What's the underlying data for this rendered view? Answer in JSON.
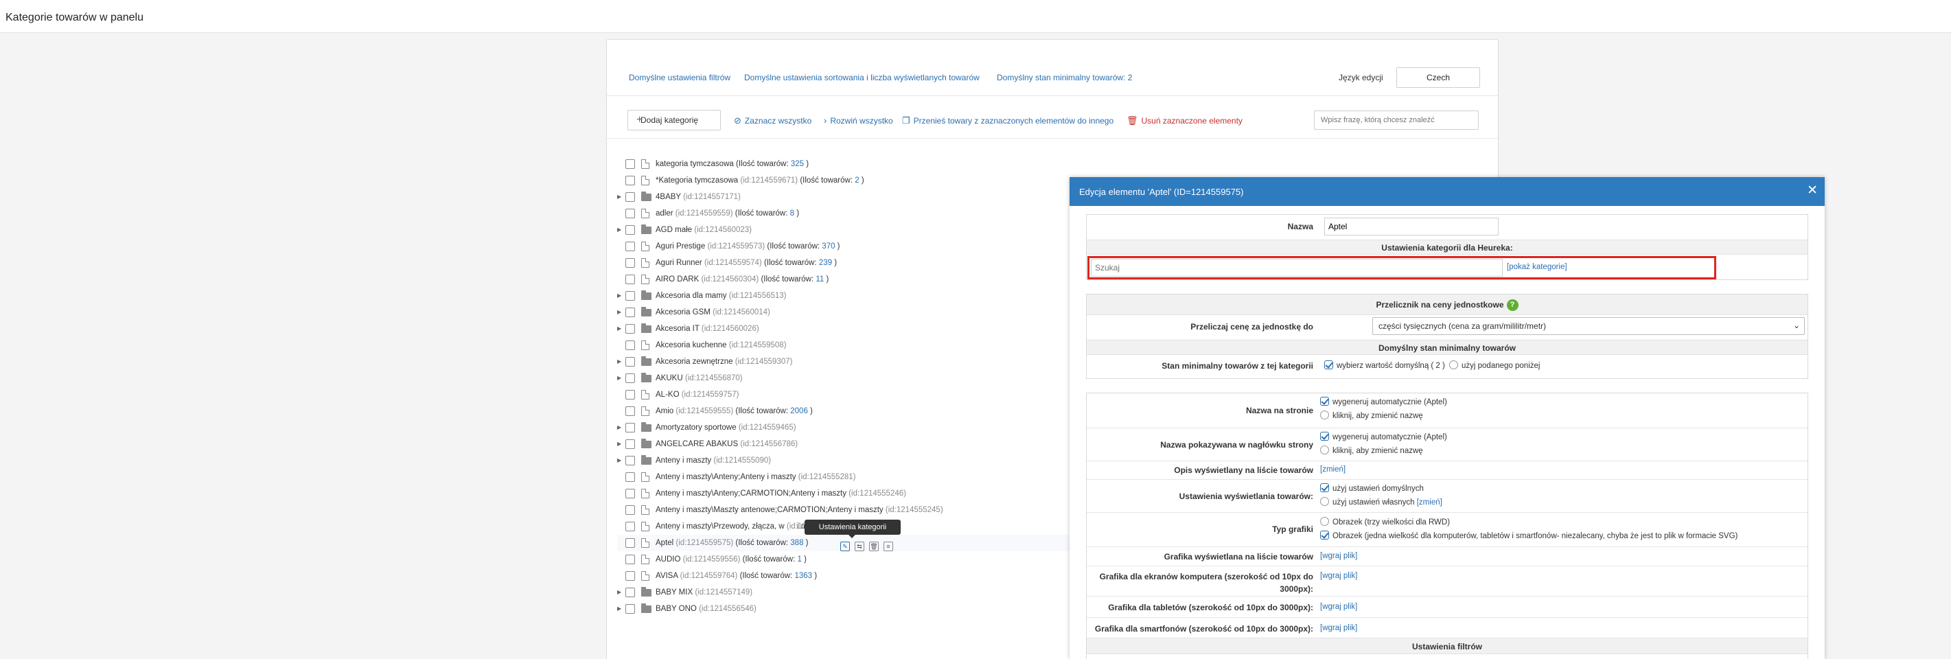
{
  "page": {
    "title": "Kategorie towarów w panelu"
  },
  "tabs": [
    "Domyślne ustawienia filtrów",
    "Domyślne ustawienia sortowania i liczba wyświetlanych towarów",
    "Domyślny stan minimalny towarów: 2"
  ],
  "language": {
    "label": "Język edycji",
    "value": "Czech"
  },
  "toolbar": {
    "add_label": "Dodaj kategorię",
    "select_all": "Zaznacz wszystko",
    "expand_all": "Rozwiń wszystko",
    "move_products": "Przenieś towary z zaznaczonych elementów do innego",
    "delete_selected": "Usuń zaznaczone elementy",
    "search_placeholder": "Wpisz frazę, którą chcesz znaleźć"
  },
  "tree": [
    {
      "name": "kategoria tymczasowa",
      "id": "",
      "count_label": "(Ilość towarów: ",
      "count": "325",
      "count_end": " )",
      "folder": false,
      "expandable": false
    },
    {
      "name": "*Kategoria tymczasowa",
      "id": "(id:1214559671)",
      "count_label": "(Ilość towarów: ",
      "count": "2",
      "count_end": " )",
      "folder": false,
      "expandable": false
    },
    {
      "name": "4BABY",
      "id": "(id:1214557171)",
      "count_label": "",
      "count": "",
      "count_end": "",
      "folder": true,
      "expandable": true
    },
    {
      "name": "adler",
      "id": "(id:1214559559)",
      "count_label": "(Ilość towarów: ",
      "count": "8",
      "count_end": " )",
      "folder": false,
      "expandable": false
    },
    {
      "name": "AGD małe",
      "id": "(id:1214560023)",
      "count_label": "",
      "count": "",
      "count_end": "",
      "folder": true,
      "expandable": true
    },
    {
      "name": "Aguri Prestige",
      "id": "(id:1214559573)",
      "count_label": "(Ilość towarów: ",
      "count": "370",
      "count_end": " )",
      "folder": false,
      "expandable": false
    },
    {
      "name": "Aguri Runner",
      "id": "(id:1214559574)",
      "count_label": "(Ilość towarów: ",
      "count": "239",
      "count_end": " )",
      "folder": false,
      "expandable": false
    },
    {
      "name": "AIRO DARK",
      "id": "(id:1214560304)",
      "count_label": "(Ilość towarów: ",
      "count": "11",
      "count_end": " )",
      "folder": false,
      "expandable": false
    },
    {
      "name": "Akcesoria dla mamy",
      "id": "(id:1214556513)",
      "count_label": "",
      "count": "",
      "count_end": "",
      "folder": true,
      "expandable": true
    },
    {
      "name": "Akcesoria GSM",
      "id": "(id:1214560014)",
      "count_label": "",
      "count": "",
      "count_end": "",
      "folder": true,
      "expandable": true
    },
    {
      "name": "Akcesoria IT",
      "id": "(id:1214560026)",
      "count_label": "",
      "count": "",
      "count_end": "",
      "folder": true,
      "expandable": true
    },
    {
      "name": "Akcesoria kuchenne",
      "id": "(id:1214559508)",
      "count_label": "",
      "count": "",
      "count_end": "",
      "folder": false,
      "expandable": false
    },
    {
      "name": "Akcesoria zewnętrzne",
      "id": "(id:1214559307)",
      "count_label": "",
      "count": "",
      "count_end": "",
      "folder": true,
      "expandable": true
    },
    {
      "name": "AKUKU",
      "id": "(id:1214556870)",
      "count_label": "",
      "count": "",
      "count_end": "",
      "folder": true,
      "expandable": true
    },
    {
      "name": "AL-KO",
      "id": "(id:1214559757)",
      "count_label": "",
      "count": "",
      "count_end": "",
      "folder": false,
      "expandable": false
    },
    {
      "name": "Amio",
      "id": "(id:1214559555)",
      "count_label": "(Ilość towarów: ",
      "count": "2006",
      "count_end": " )",
      "folder": false,
      "expandable": false
    },
    {
      "name": "Amortyzatory sportowe",
      "id": "(id:1214559465)",
      "count_label": "",
      "count": "",
      "count_end": "",
      "folder": true,
      "expandable": true
    },
    {
      "name": "ANGELCARE ABAKUS",
      "id": "(id:1214556786)",
      "count_label": "",
      "count": "",
      "count_end": "",
      "folder": true,
      "expandable": true
    },
    {
      "name": "Anteny i maszty",
      "id": "(id:1214555090)",
      "count_label": "",
      "count": "",
      "count_end": "",
      "folder": true,
      "expandable": true
    },
    {
      "name": "Anteny i maszty\\Anteny;Anteny i maszty",
      "id": "(id:1214555281)",
      "count_label": "",
      "count": "",
      "count_end": "",
      "folder": false,
      "expandable": false
    },
    {
      "name": "Anteny i maszty\\Anteny;CARMOTION;Anteny i maszty",
      "id": "(id:1214555246)",
      "count_label": "",
      "count": "",
      "count_end": "",
      "folder": false,
      "expandable": false
    },
    {
      "name": "Anteny i maszty\\Maszty antenowe;CARMOTION;Anteny i maszty",
      "id": "(id:1214555245)",
      "count_label": "",
      "count": "",
      "count_end": "",
      "folder": false,
      "expandable": false
    },
    {
      "name": "Anteny i maszty\\Przewody, złącza, w",
      "id": "(id:1214555259)",
      "count_label": "",
      "count": "",
      "count_end": "",
      "folder": false,
      "expandable": false,
      "tail": "i maszty"
    },
    {
      "name": "Aptel",
      "id": "(id:1214559575)",
      "count_label": "(Ilość towarów: ",
      "count": "388",
      "count_end": " )",
      "folder": false,
      "expandable": false
    },
    {
      "name": "AUDIO",
      "id": "(id:1214559556)",
      "count_label": "(Ilość towarów: ",
      "count": "1",
      "count_end": " )",
      "folder": false,
      "expandable": false
    },
    {
      "name": "AVISA",
      "id": "(id:1214559764)",
      "count_label": "(Ilość towarów: ",
      "count": "1363",
      "count_end": " )",
      "folder": false,
      "expandable": false
    },
    {
      "name": "BABY MIX",
      "id": "(id:1214557149)",
      "count_label": "",
      "count": "",
      "count_end": "",
      "folder": true,
      "expandable": true
    },
    {
      "name": "BABY ONO",
      "id": "(id:1214556546)",
      "count_label": "",
      "count": "",
      "count_end": "",
      "folder": true,
      "expandable": true
    }
  ],
  "tooltip": "Ustawienia kategorii",
  "modal": {
    "title": "Edycja elementu 'Aptel' (ID=1214559575)",
    "close": "✕",
    "name_label": "Nazwa",
    "name_value": "Aptel",
    "heureka_header": "Ustawienia kategorii dla Heureka:",
    "heureka_placeholder": "Szukaj",
    "heureka_link": "[pokaż kategorie]",
    "unit_header": "Przelicznik na ceny jednostkowe",
    "unit_label": "Przeliczaj cenę za jednostkę do",
    "unit_value": "części tysięcznych (cena za gram/mililitr/metr)",
    "min_header": "Domyślny stan minimalny towarów",
    "min_label": "Stan minimalny towarów z tej kategorii",
    "min_opt1": "wybierz wartość domyślną ( 2 )",
    "min_opt2": "użyj podanego poniżej",
    "page_name_label": "Nazwa na stronie",
    "auto_opt": "wygeneruj automatycznie (Aptel)",
    "manual_opt": "kliknij, aby zmienić nazwę",
    "header_name_label": "Nazwa pokazywana w nagłówku strony",
    "desc_label": "Opis wyświetlany na liście towarów",
    "change_link": "[zmień]",
    "display_label": "Ustawienia wyświetlania towarów:",
    "display_opt1": "użyj ustawień domyślnych",
    "display_opt2": "użyj ustawień własnych",
    "graphic_type_label": "Typ grafiki",
    "graphic_opt1": "Obrazek (trzy wielkości dla RWD)",
    "graphic_opt2": "Obrazek (jedna wielkość dla komputerów, tabletów i smartfonów- niezalecany, chyba że jest to plik w formacie SVG)",
    "graphic_list_label": "Grafika wyświetlana na liście towarów",
    "upload_link": "[wgraj plik]",
    "graphic_pc_label": "Grafika dla ekranów komputera (szerokość od 10px do 3000px):",
    "graphic_tab_label": "Grafika dla tabletów (szerokość od 10px do 3000px):",
    "graphic_phone_label": "Grafika dla smartfonów (szerokość od 10px do 3000px):",
    "filters_header": "Ustawienia filtrów"
  },
  "colors": {
    "accent": "#2f7bbf",
    "link": "#2a6fb0",
    "danger": "#c53030",
    "highlight": "#e0241d"
  }
}
